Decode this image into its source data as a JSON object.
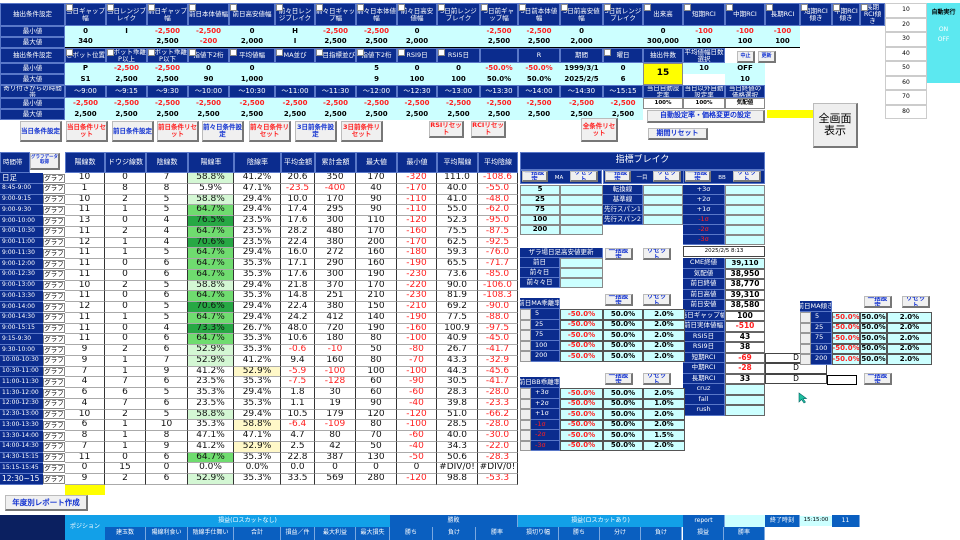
{
  "top": {
    "row1_label": "抽出条件設定",
    "row1_headers": [
      "当日ギャップ幅",
      "当日レンジブレイク",
      "前日ギャップ幅",
      "前日本体値幅",
      "前日高安値幅",
      "前々日レンジブレイク",
      "前々日ギャップ幅",
      "前々日本体値幅",
      "前々日高安値幅",
      "3日前レンジブレイク",
      "3日前ギャップ幅",
      "3日前本体値幅",
      "3日前高安値幅",
      "3日前レンジブレイク",
      "出来高",
      "短期RCI",
      "中期RCI",
      "長期RCI",
      "短期RCI傾き",
      "中期RCI傾き",
      "長期RCI傾き"
    ],
    "min_label": "最小値",
    "max_label": "最大値",
    "row1_min": [
      "0",
      "I",
      "-2,500",
      "-2,500",
      "0",
      "H",
      "-2,500",
      "-2,500",
      "0",
      "",
      "-2,500",
      "-2,500",
      "0",
      "",
      "0",
      "-100",
      "-100",
      "-100",
      "",
      "",
      ""
    ],
    "row1_max": [
      "340",
      "",
      "2,500",
      "-200",
      "2,000",
      "I",
      "2,500",
      "2,500",
      "2,000",
      "",
      "2,500",
      "2,500",
      "2,000",
      "",
      "300,000",
      "100",
      "100",
      "100",
      "",
      "",
      ""
    ],
    "row2_label": "抽出条件設定",
    "row2_headers": [
      "ピボット位置",
      "ピボット乖離P以上",
      "ピボット乖離P以下",
      "指値下2桁",
      "平均値幅",
      "MA並び",
      "一目指標並び",
      "指値下2桁",
      "RSI9日",
      "RSI5日",
      "",
      "R",
      "期間",
      "曜日",
      "抽出件数",
      "平均値幅日数選択"
    ],
    "row2_min": [
      "P",
      "-2,500",
      "-2,500",
      "0",
      "0",
      "",
      "",
      "5",
      "0",
      "0",
      "-50.0%",
      "-50.0%",
      "1999/3/1",
      "0",
      "15",
      "10",
      "OFF"
    ],
    "row2_max": [
      "S1",
      "2,500",
      "2,500",
      "90",
      "1,000",
      "",
      "",
      "9",
      "100",
      "100",
      "50.0%",
      "50.0%",
      "2025/2/5",
      "6",
      "",
      "",
      "10"
    ],
    "stop_button": "中止",
    "update_button": "更新",
    "time_label": "寄り付きからの時間帯",
    "time_headers": [
      "～9:00",
      "～9:15",
      "～9:30",
      "～10:00",
      "～10:30",
      "～11:00",
      "～11:30",
      "～12:00",
      "～12:30",
      "～13:00",
      "～13:30",
      "～14:00",
      "～14:30",
      "～15:15",
      "当日自動設定率",
      "当日以外自動設定率",
      "当日終値の価格選択"
    ],
    "time_min": [
      "-2,500",
      "-2,500",
      "-2,500",
      "-2,500",
      "-2,500",
      "-2,500",
      "-2,500",
      "-2,500",
      "-2,500",
      "-2,500",
      "-2,500",
      "-2,500",
      "-2,500",
      "-2,500",
      "100%",
      "100%",
      "気配値"
    ],
    "time_max": [
      "2,500",
      "2,500",
      "2,500",
      "2,500",
      "2,500",
      "2,500",
      "2,500",
      "2,500",
      "2,500",
      "2,500",
      "2,500",
      "2,500",
      "2,500",
      "2,500",
      "",
      "",
      ""
    ],
    "side_numbers": [
      "10",
      "20",
      "30",
      "40",
      "50",
      "60",
      "70",
      "80"
    ],
    "auto_label": "自動実行",
    "auto_on": "ON",
    "auto_off": "OFF"
  },
  "buttons": {
    "today_set": "当日条件設定",
    "today_reset": "当日条件リセット",
    "prev_set": "前日条件設定",
    "prev_reset": "前日条件リセット",
    "prev2_set": "前々日条件設定",
    "prev2_reset": "前々日条件リセット",
    "prev3_set": "3日前条件設定",
    "prev3_reset": "3日前条件リセット",
    "rsi_reset": "RSIリセット",
    "rci_reset": "RCIリセット",
    "all_reset": "全条件リセット",
    "auto_rate": "自動設定率・価格変更の設定",
    "period_reset": "期間リセット",
    "fullscreen": "全画面表示",
    "yearly_report": "年度別レポート作成"
  },
  "main": {
    "time_header": "時間帯",
    "graph_data_button": "グラフデータ取得",
    "graph_button": "グラフ",
    "columns": [
      "陽線数",
      "ドウジ線数",
      "陰線数",
      "陽線率",
      "陰線率",
      "平均金額",
      "累計金額",
      "最大値",
      "最小値",
      "平均陽線",
      "平均陰線"
    ],
    "rows": [
      [
        "日足",
        "10",
        "0",
        "7",
        "58.8%",
        "41.2%",
        "20.6",
        "350",
        "170",
        "-320",
        "111.0",
        "-108.6"
      ],
      [
        "8:45-9:00",
        "1",
        "8",
        "8",
        "5.9%",
        "47.1%",
        "-23.5",
        "-400",
        "40",
        "-170",
        "40.0",
        "-55.0"
      ],
      [
        "9:00-9:15",
        "10",
        "2",
        "5",
        "58.8%",
        "29.4%",
        "10.0",
        "170",
        "90",
        "-110",
        "41.0",
        "-48.0"
      ],
      [
        "9:00-9:30",
        "11",
        "1",
        "5",
        "64.7%",
        "29.4%",
        "17.4",
        "295",
        "90",
        "-110",
        "55.0",
        "-62.0"
      ],
      [
        "9:00-10:00",
        "13",
        "0",
        "4",
        "76.5%",
        "23.5%",
        "17.6",
        "300",
        "110",
        "-120",
        "52.3",
        "-95.0"
      ],
      [
        "9:00-10:30",
        "11",
        "2",
        "4",
        "64.7%",
        "23.5%",
        "28.2",
        "480",
        "170",
        "-160",
        "75.5",
        "-87.5"
      ],
      [
        "9:00-11:00",
        "12",
        "1",
        "4",
        "70.6%",
        "23.5%",
        "22.4",
        "380",
        "200",
        "-170",
        "62.5",
        "-92.5"
      ],
      [
        "9:00-11:30",
        "11",
        "1",
        "5",
        "64.7%",
        "29.4%",
        "16.0",
        "272",
        "160",
        "-180",
        "59.3",
        "-76.0"
      ],
      [
        "9:00-12:00",
        "11",
        "0",
        "6",
        "64.7%",
        "35.3%",
        "17.1",
        "290",
        "160",
        "-190",
        "65.5",
        "-71.7"
      ],
      [
        "9:00-12:30",
        "11",
        "0",
        "6",
        "64.7%",
        "35.3%",
        "17.6",
        "300",
        "190",
        "-230",
        "73.6",
        "-85.0"
      ],
      [
        "9:00-13:00",
        "10",
        "2",
        "5",
        "58.8%",
        "29.4%",
        "21.8",
        "370",
        "170",
        "-220",
        "90.0",
        "-106.0"
      ],
      [
        "9:00-13:30",
        "11",
        "0",
        "6",
        "64.7%",
        "35.3%",
        "14.8",
        "251",
        "210",
        "-230",
        "81.9",
        "-108.3"
      ],
      [
        "9:00-14:00",
        "12",
        "0",
        "5",
        "70.6%",
        "29.4%",
        "22.4",
        "380",
        "150",
        "-210",
        "69.2",
        "-90.0"
      ],
      [
        "9:00-14:30",
        "11",
        "1",
        "5",
        "64.7%",
        "29.4%",
        "24.2",
        "412",
        "140",
        "-190",
        "77.5",
        "-88.0"
      ],
      [
        "9:00-15:15",
        "11",
        "0",
        "4",
        "73.3%",
        "26.7%",
        "48.0",
        "720",
        "190",
        "-160",
        "100.9",
        "-97.5"
      ],
      [
        "9:15-9:30",
        "11",
        "0",
        "6",
        "64.7%",
        "35.3%",
        "10.6",
        "180",
        "80",
        "-100",
        "40.9",
        "-45.0"
      ],
      [
        "9:30-10:00",
        "9",
        "2",
        "6",
        "52.9%",
        "35.3%",
        "-0.6",
        "-10",
        "50",
        "-80",
        "26.7",
        "-41.7"
      ],
      [
        "10:00-10:30",
        "9",
        "1",
        "7",
        "52.9%",
        "41.2%",
        "9.4",
        "160",
        "80",
        "-70",
        "43.3",
        "-32.9"
      ],
      [
        "10:30-11:00",
        "7",
        "1",
        "9",
        "41.2%",
        "52.9%",
        "-5.9",
        "-100",
        "100",
        "-100",
        "44.3",
        "-45.6"
      ],
      [
        "11:00-11:30",
        "4",
        "7",
        "6",
        "23.5%",
        "35.3%",
        "-7.5",
        "-128",
        "60",
        "-90",
        "30.5",
        "-41.7"
      ],
      [
        "11:30-12:00",
        "6",
        "6",
        "5",
        "35.3%",
        "29.4%",
        "1.8",
        "30",
        "60",
        "-60",
        "28.3",
        "-28.0"
      ],
      [
        "12:00-12:30",
        "4",
        "7",
        "6",
        "23.5%",
        "35.3%",
        "1.1",
        "19",
        "90",
        "-40",
        "39.8",
        "-23.3"
      ],
      [
        "12:30-13:00",
        "10",
        "2",
        "5",
        "58.8%",
        "29.4%",
        "10.5",
        "179",
        "120",
        "-120",
        "51.0",
        "-66.2"
      ],
      [
        "13:00-13:30",
        "6",
        "1",
        "10",
        "35.3%",
        "58.8%",
        "-6.4",
        "-109",
        "80",
        "-100",
        "28.5",
        "-28.0"
      ],
      [
        "13:30-14:00",
        "8",
        "1",
        "8",
        "47.1%",
        "47.1%",
        "4.7",
        "80",
        "70",
        "-60",
        "40.0",
        "-30.0"
      ],
      [
        "14:00-14:30",
        "7",
        "1",
        "9",
        "41.2%",
        "52.9%",
        "2.5",
        "42",
        "50",
        "-40",
        "34.3",
        "-22.0"
      ],
      [
        "14:30-15:15",
        "11",
        "0",
        "6",
        "64.7%",
        "35.3%",
        "22.8",
        "387",
        "130",
        "-50",
        "50.6",
        "-28.3"
      ],
      [
        "15:15-15:45",
        "0",
        "15",
        "0",
        "0.0%",
        "0.0%",
        "0.0",
        "0",
        "0",
        "0",
        "#DIV/0!",
        "#DIV/0!"
      ],
      [
        "12:30~15",
        "9",
        "2",
        "6",
        "52.9%",
        "35.3%",
        "33.5",
        "569",
        "280",
        "-120",
        "98.8",
        "-53.3"
      ]
    ]
  },
  "indicator": {
    "title": "指標ブレイク",
    "bulk_set": "一括設定",
    "reset": "リセット",
    "ma_label": "MA",
    "ichimoku_label": "一目",
    "bb_label": "BB",
    "ma_items": [
      "5",
      "25",
      "75",
      "100",
      "200"
    ],
    "ichimoku_items": [
      "転換線",
      "基準線",
      "先行スパン1",
      "先行スパン2"
    ],
    "bb_items": [
      "+3σ",
      "+2σ",
      "+1σ",
      "-1σ",
      "-2σ",
      "-3σ"
    ],
    "zaraba_title": "ザラ場日足高安値更新",
    "zaraba_items": [
      "前日",
      "前々日",
      "前々々日"
    ],
    "timestamp": "2025/2/5 8:13",
    "quotes": [
      [
        "CME終値",
        "39,110",
        ""
      ],
      [
        "気配値",
        "38,950",
        ""
      ],
      [
        "前日終値",
        "38,770",
        ""
      ],
      [
        "前日高値",
        "39,310",
        ""
      ],
      [
        "前日安値",
        "38,580",
        ""
      ],
      [
        "当日ギャップ幅",
        "100",
        ""
      ],
      [
        "前日実体値幅",
        "-510",
        ""
      ],
      [
        "RSI5日",
        "43",
        ""
      ],
      [
        "RSI9日",
        "38",
        ""
      ],
      [
        "短期RCI",
        "-69",
        "D"
      ],
      [
        "中期RCI",
        "-28",
        "D"
      ],
      [
        "長期RCI",
        "33",
        "D"
      ],
      [
        "cruz",
        "",
        ""
      ],
      [
        "fall",
        "",
        ""
      ],
      [
        "rush",
        "",
        ""
      ]
    ],
    "ma_dev_title": "前日MA乖離率",
    "ma_dev_rows": [
      [
        "5",
        "-50.0%",
        "50.0%",
        "2.0%"
      ],
      [
        "25",
        "-50.0%",
        "50.0%",
        "2.0%"
      ],
      [
        "75",
        "-50.0%",
        "50.0%",
        "2.0%"
      ],
      [
        "100",
        "-50.0%",
        "50.0%",
        "2.0%"
      ],
      [
        "200",
        "-50.0%",
        "50.0%",
        "2.0%"
      ]
    ],
    "bb_dev_title": "前日BB乖離率",
    "bb_dev_rows": [
      [
        "+3σ",
        "-50.0%",
        "50.0%",
        "2.0%"
      ],
      [
        "+2σ",
        "-50.0%",
        "50.0%",
        "1.0%"
      ],
      [
        "+1σ",
        "-50.0%",
        "50.0%",
        "2.0%"
      ],
      [
        "-1σ",
        "-50.0%",
        "50.0%",
        "2.0%"
      ],
      [
        "-2σ",
        "-50.0%",
        "50.0%",
        "1.5%"
      ],
      [
        "-3σ",
        "-50.0%",
        "50.0%",
        "2.0%"
      ]
    ],
    "ma_slope_title": "前日MA傾き",
    "ma_slope_rows": [
      [
        "5",
        "-50.0%",
        "50.0%",
        "2.0%"
      ],
      [
        "25",
        "-50.0%",
        "50.0%",
        "2.0%"
      ],
      [
        "75",
        "-50.0%",
        "50.0%",
        "2.0%"
      ],
      [
        "100",
        "-50.0%",
        "50.0%",
        "2.0%"
      ],
      [
        "200",
        "-50.0%",
        "50.0%",
        "2.0%"
      ]
    ]
  },
  "footer": {
    "position": "ポジション",
    "pl_no_losscut": "損益(ロスカットなし)",
    "pl_no_losscut_cols": [
      "建玉数",
      "陽線利食い",
      "陰線手仕舞い",
      "合計",
      "損益／件",
      "最大利益",
      "最大損失"
    ],
    "win_loss": "勝敗",
    "win_loss_cols": [
      "勝ち",
      "負け",
      "勝率"
    ],
    "pl_losscut": "損益(ロスカットあり)",
    "pl_losscut_cols": [
      "損切り幅",
      "勝ち",
      "分け",
      "負け"
    ],
    "report": "report",
    "report_cols": [
      "損益",
      "勝率"
    ],
    "end_time_label": "終了時刻",
    "end_time": "15:15:00",
    "count": "11"
  }
}
